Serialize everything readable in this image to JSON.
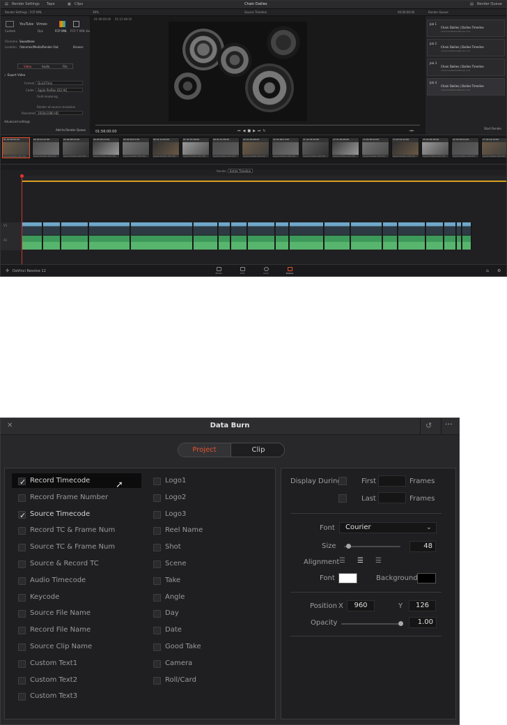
{
  "resolve": {
    "menubar": {
      "render_settings": "Render Settings",
      "tape": "Tape",
      "clips": "Clips",
      "project_title": "Chain Dailies",
      "render_queue": "Render Queue"
    },
    "render_settings": {
      "header": "Render Settings - FCP XML",
      "presets": [
        "Custom",
        "YouTube",
        "Vimeo",
        "Dpx",
        "FCP XML",
        "FCP 7 XML",
        "Var"
      ],
      "filename_label": "Filename",
      "filename_value": "Soundtone",
      "location_label": "Location",
      "location_value": "/Volumes/Media/Render Out",
      "browse": "Browse",
      "tabs": [
        "Video",
        "Audio",
        "File"
      ],
      "export_video": "Export Video",
      "format_label": "Format",
      "format_value": "QuickTime",
      "codec_label": "Codec",
      "codec_value": "Apple ProRes 422 HQ",
      "field_rendering": "Field rendering",
      "render_at_source": "Render at source resolution",
      "resolution_label": "Resolution",
      "resolution_value": "1920x1080 HD",
      "advanced": "Advanced settings",
      "add_queue": "Add to Render Queue"
    },
    "viewer": {
      "zoom": "39%",
      "source_label": "Source Timeline",
      "tc_top": "00:00:00:00",
      "tc_start": "01:00:00:00",
      "tc_end": "01:15:48:10",
      "timecode": "01:56:00:00"
    },
    "render_queue": {
      "title": "Render Queue",
      "jobs": [
        {
          "n": "Job 1",
          "title": "Chain Dailies | Dailies Timeline",
          "sub": "/Volumes/Media/Render Out"
        },
        {
          "n": "Job 2",
          "title": "Chain Dailies | Dailies Timeline",
          "sub": "/Volumes/Media/Render Out"
        },
        {
          "n": "Job 3",
          "title": "Chain Dailies | Dailies Timeline",
          "sub": "/Volumes/Media/Render Out"
        },
        {
          "n": "Job 4",
          "title": "Chain Dailies | Dailies Timeline",
          "sub": "/Volumes/Media/Render Out"
        }
      ],
      "start_render": "Start Render"
    },
    "clips": [
      {
        "tc": "01 00:00:00:00",
        "cap": "Apple ProRes 422 HQ"
      },
      {
        "tc": "02 00:11:47:00",
        "cap": "Apple ProRes 422 HQ"
      },
      {
        "tc": "03 00:38:15:00",
        "cap": "Apple ProRes 422 HQ"
      },
      {
        "tc": "04 00:35:21:09",
        "cap": "Apple ProRes 422 HQ"
      },
      {
        "tc": "05 00:52:07:00",
        "cap": "Apple ProRes 422 HQ"
      },
      {
        "tc": "06 01:11:00:00",
        "cap": "Apple ProRes 422 HQ"
      },
      {
        "tc": "07 01:15:18:00",
        "cap": "Apple ProRes 422 HQ"
      },
      {
        "tc": "08 01:21:48:00",
        "cap": "Apple ProRes 422 HQ"
      },
      {
        "tc": "09 01:26:48:00",
        "cap": "Apple ProRes 422 HQ"
      },
      {
        "tc": "10 01:28:17:00",
        "cap": "Apple ProRes 422 HQ"
      },
      {
        "tc": "11 01:32:24:00",
        "cap": "Apple ProRes 422 HQ"
      },
      {
        "tc": "12 01:39:48:00",
        "cap": "Apple ProRes 422 HQ"
      },
      {
        "tc": "13 02:00:24:00",
        "cap": "Apple ProRes 422 HQ"
      },
      {
        "tc": "14 02:01:24:00",
        "cap": "Apple ProRes 422 HQ"
      },
      {
        "tc": "15 02:05:28:00",
        "cap": "Apple ProRes 422 HQ"
      },
      {
        "tc": "16 02:09:52:00",
        "cap": "Apple ProRes 422 HQ"
      },
      {
        "tc": "17 02:14:13:00",
        "cap": "Apple ProRes 422 HQ"
      }
    ],
    "timeline": {
      "render_label": "Render",
      "render_value": "Entire Timeline"
    },
    "app_name": "DaVinci Resolve 12",
    "pages": [
      "Media",
      "Edit",
      "Color",
      "Deliver"
    ]
  },
  "dialog": {
    "title": "Data Burn",
    "segments": {
      "project": "Project",
      "clip": "Clip"
    },
    "left_column": [
      {
        "label": "Record Timecode",
        "checked": true
      },
      {
        "label": "Record Frame Number",
        "checked": false
      },
      {
        "label": "Source Timecode",
        "checked": true
      },
      {
        "label": "Record TC & Frame Num",
        "checked": false
      },
      {
        "label": "Source TC & Frame Num",
        "checked": false
      },
      {
        "label": "Source & Record TC",
        "checked": false
      },
      {
        "label": "Audio Timecode",
        "checked": false
      },
      {
        "label": "Keycode",
        "checked": false
      },
      {
        "label": "Source File Name",
        "checked": false
      },
      {
        "label": "Record File Name",
        "checked": false
      },
      {
        "label": "Source Clip Name",
        "checked": false
      },
      {
        "label": "Custom Text1",
        "checked": false
      },
      {
        "label": "Custom Text2",
        "checked": false
      },
      {
        "label": "Custom Text3",
        "checked": false
      }
    ],
    "right_column": [
      {
        "label": "Logo1",
        "checked": false
      },
      {
        "label": "Logo2",
        "checked": false
      },
      {
        "label": "Logo3",
        "checked": false
      },
      {
        "label": "Reel Name",
        "checked": false
      },
      {
        "label": "Shot",
        "checked": false
      },
      {
        "label": "Scene",
        "checked": false
      },
      {
        "label": "Take",
        "checked": false
      },
      {
        "label": "Angle",
        "checked": false
      },
      {
        "label": "Day",
        "checked": false
      },
      {
        "label": "Date",
        "checked": false
      },
      {
        "label": "Good Take",
        "checked": false
      },
      {
        "label": "Camera",
        "checked": false
      },
      {
        "label": "Roll/Card",
        "checked": false
      }
    ],
    "settings": {
      "display_during": "Display During",
      "first": "First",
      "last": "Last",
      "frames": "Frames",
      "font_label": "Font",
      "font_value": "Courier",
      "size_label": "Size",
      "size_value": "48",
      "size_fraction": 0.08,
      "alignment_label": "Alignment",
      "font_color_label": "Font",
      "font_color": "#ffffff",
      "background_label": "Background",
      "background_color": "#000000",
      "position_label": "Position",
      "x_label": "X",
      "x_value": "960",
      "y_label": "Y",
      "y_value": "126",
      "opacity_label": "Opacity",
      "opacity_value": "1.00",
      "opacity_fraction": 1.0
    },
    "accent_color": "#e8532e"
  }
}
